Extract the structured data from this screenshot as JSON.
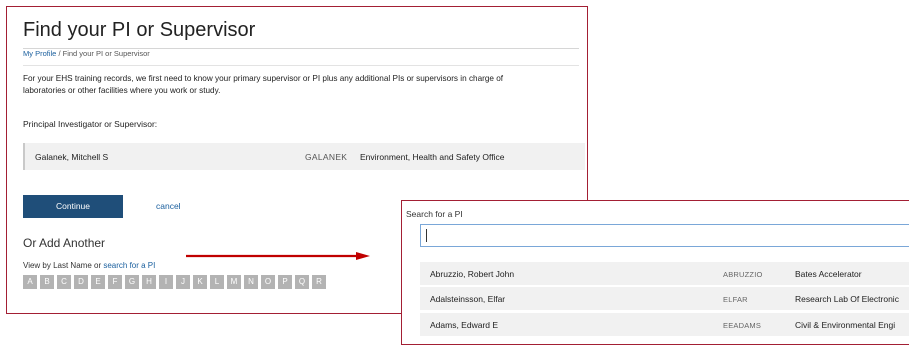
{
  "page": {
    "title": "Find your PI or Supervisor",
    "breadcrumb": {
      "home": "My Profile",
      "sep": "/",
      "current": "Find your PI or Supervisor"
    },
    "intro": "For your EHS training records, we first need to know your primary supervisor or PI plus any additional PIs or supervisors in charge of laboratories or other facilities where you work or study.",
    "pi_label": "Principal Investigator or Supervisor:",
    "selected_pi": {
      "name": "Galanek, Mitchell S",
      "kerberos": "GALANEK",
      "department": "Environment, Health and Safety Office"
    },
    "continue_label": "Continue",
    "cancel_label": "cancel",
    "add_another_heading": "Or Add Another",
    "view_by_text": "View by Last Name or",
    "search_link": "search for a PI",
    "letters": [
      "A",
      "B",
      "C",
      "D",
      "E",
      "F",
      "G",
      "H",
      "I",
      "J",
      "K",
      "L",
      "M",
      "N",
      "O",
      "P",
      "Q",
      "R"
    ]
  },
  "search_panel": {
    "label": "Search for a PI",
    "input_value": "",
    "results": [
      {
        "name": "Abruzzio, Robert John",
        "kerberos": "ABRUZZIO",
        "department": "Bates Accelerator"
      },
      {
        "name": "Adalsteinsson, Elfar",
        "kerberos": "ELFAR",
        "department": "Research Lab Of Electronic"
      },
      {
        "name": "Adams, Edward E",
        "kerberos": "EEADAMS",
        "department": "Civil & Environmental Engi"
      }
    ]
  },
  "colors": {
    "accent_border": "#a31f34",
    "button": "#1f4e79",
    "link": "#1a5f9e",
    "letter_bg": "#b3b3b3",
    "arrow": "#c00000"
  }
}
